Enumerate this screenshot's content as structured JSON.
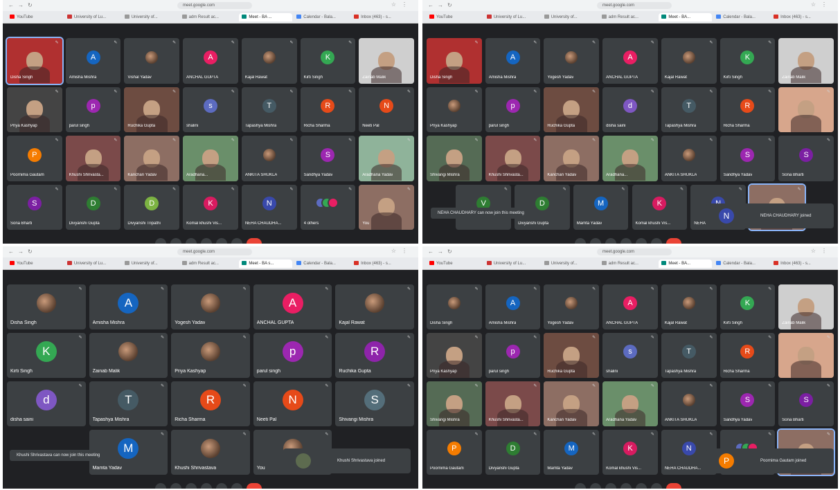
{
  "panels": [
    {
      "url": "meet.google.com",
      "big": false,
      "tabs": [
        {
          "label": "YouTube",
          "color": "#ff0000",
          "active": false
        },
        {
          "label": "University of Lu...",
          "color": "#cc3333",
          "active": false
        },
        {
          "label": "University of...",
          "color": "#999999",
          "active": false
        },
        {
          "label": "adm Result ac...",
          "color": "#999999",
          "active": false
        },
        {
          "label": "Meet - BA ...",
          "color": "#00897b",
          "active": true
        },
        {
          "label": "Calendar - Bala...",
          "color": "#4285f4",
          "active": false
        },
        {
          "label": "Inbox (463) - s...",
          "color": "#d93025",
          "active": false
        }
      ],
      "tiles": [
        {
          "name": "Disha Singh",
          "kind": "video",
          "color": "#b03030",
          "self": true
        },
        {
          "name": "Amisha Mishra",
          "kind": "avatar",
          "letter": "A",
          "color": "#1565c0"
        },
        {
          "name": "Vishal Yadav",
          "kind": "photo"
        },
        {
          "name": "ANCHAL GUPTA",
          "kind": "avatar",
          "letter": "A",
          "color": "#e91e63"
        },
        {
          "name": "Kajal Rawat",
          "kind": "photo"
        },
        {
          "name": "Kirti Singh",
          "kind": "avatar",
          "letter": "K",
          "color": "#34a853"
        },
        {
          "name": "Zainab Malik",
          "kind": "video",
          "color": "#cfcfcf"
        },
        {
          "name": "Priya Kashyap",
          "kind": "video",
          "color": "#444444"
        },
        {
          "name": "parul singh",
          "kind": "avatar",
          "letter": "p",
          "color": "#9c27b0"
        },
        {
          "name": "Ruchika Gupta",
          "kind": "video",
          "color": "#6d4c41"
        },
        {
          "name": "shalini",
          "kind": "avatar",
          "letter": "s",
          "color": "#5c6bc0"
        },
        {
          "name": "Tapashya Mishra",
          "kind": "avatar",
          "letter": "T",
          "color": "#455a64"
        },
        {
          "name": "Richa Sharma",
          "kind": "avatar",
          "letter": "R",
          "color": "#e64a19"
        },
        {
          "name": "Neeti Pal",
          "kind": "avatar",
          "letter": "N",
          "color": "#e64a19"
        },
        {
          "name": "Poornima Gautam",
          "kind": "avatar",
          "letter": "P",
          "color": "#f57c00"
        },
        {
          "name": "Khushi Shrivasta...",
          "kind": "video",
          "color": "#7b4a4a"
        },
        {
          "name": "Kanchan Yadav",
          "kind": "video",
          "color": "#8d6e63"
        },
        {
          "name": "Aradhana...",
          "kind": "video",
          "color": "#6a8f6a"
        },
        {
          "name": "ANKITA SHUKLA",
          "kind": "photo"
        },
        {
          "name": "Sandhya Yadav",
          "kind": "avatar",
          "letter": "S",
          "color": "#9c27b0"
        },
        {
          "name": "Aradhana Yadav",
          "kind": "video",
          "color": "#8fb39a"
        },
        {
          "name": "Sona Bharti",
          "kind": "avatar",
          "letter": "S",
          "color": "#7b1fa2"
        },
        {
          "name": "Divyanshi Gupta",
          "kind": "avatar",
          "letter": "D",
          "color": "#2e7d32"
        },
        {
          "name": "Divyanshi Tripathi",
          "kind": "avatar",
          "letter": "D",
          "color": "#7cb342"
        },
        {
          "name": "Komal khushi Vis...",
          "kind": "avatar",
          "letter": "K",
          "color": "#d81b60"
        },
        {
          "name": "NEHA CHAUDHA...",
          "kind": "avatar",
          "letter": "N",
          "color": "#3949ab"
        },
        {
          "name": "4 others",
          "kind": "others"
        },
        {
          "name": "You",
          "kind": "video",
          "color": "#8d6e63"
        }
      ]
    },
    {
      "url": "meet.google.com",
      "big": false,
      "tabs": [
        {
          "label": "YouTube",
          "color": "#ff0000",
          "active": false
        },
        {
          "label": "University of Lu...",
          "color": "#cc3333",
          "active": false
        },
        {
          "label": "University of...",
          "color": "#999999",
          "active": false
        },
        {
          "label": "adm Result ac...",
          "color": "#999999",
          "active": false
        },
        {
          "label": "Meet - BA...",
          "color": "#00897b",
          "active": true
        },
        {
          "label": "Calendar - Bala...",
          "color": "#4285f4",
          "active": false
        },
        {
          "label": "Inbox (463) - s...",
          "color": "#d93025",
          "active": false
        }
      ],
      "tiles": [
        {
          "name": "Disha Singh",
          "kind": "video",
          "color": "#b03030"
        },
        {
          "name": "Amisha Mishra",
          "kind": "avatar",
          "letter": "A",
          "color": "#1565c0"
        },
        {
          "name": "Yogesh Yadav",
          "kind": "photo"
        },
        {
          "name": "ANCHAL GUPTA",
          "kind": "avatar",
          "letter": "A",
          "color": "#e91e63"
        },
        {
          "name": "Kajal Rawat",
          "kind": "photo"
        },
        {
          "name": "Kirti Singh",
          "kind": "avatar",
          "letter": "K",
          "color": "#34a853"
        },
        {
          "name": "Zainab Malik",
          "kind": "video",
          "color": "#cfcfcf"
        },
        {
          "name": "Priya Kashyap",
          "kind": "photo"
        },
        {
          "name": "parul singh",
          "kind": "avatar",
          "letter": "p",
          "color": "#9c27b0"
        },
        {
          "name": "Ruchika Gupta",
          "kind": "video",
          "color": "#6d4c41"
        },
        {
          "name": "disha saini",
          "kind": "avatar",
          "letter": "d",
          "color": "#7e57c2"
        },
        {
          "name": "Tapashya Mishra",
          "kind": "avatar",
          "letter": "T",
          "color": "#455a64"
        },
        {
          "name": "Richa Sharma",
          "kind": "avatar",
          "letter": "R",
          "color": "#e64a19"
        },
        {
          "name": "",
          "kind": "video",
          "color": "#d7a68c"
        },
        {
          "name": "Shivangi Mishra",
          "kind": "video",
          "color": "#556b55"
        },
        {
          "name": "Khushi Shrivasta...",
          "kind": "video",
          "color": "#7b4a4a"
        },
        {
          "name": "Kanchan Yadav",
          "kind": "video",
          "color": "#8d6e63"
        },
        {
          "name": "Aradhana...",
          "kind": "video",
          "color": "#6a8f6a"
        },
        {
          "name": "ANKITA SHUKLA",
          "kind": "photo"
        },
        {
          "name": "Sandhya Yadav",
          "kind": "avatar",
          "letter": "S",
          "color": "#9c27b0"
        },
        {
          "name": "Sona Bharti",
          "kind": "avatar",
          "letter": "S",
          "color": "#7b1fa2"
        },
        {
          "name": "",
          "kind": "avatar",
          "letter": "V",
          "color": "#2e7d32"
        },
        {
          "name": "Divyanshi Gupta",
          "kind": "avatar",
          "letter": "D",
          "color": "#2e7d32"
        },
        {
          "name": "Mamta Yadav",
          "kind": "avatar",
          "letter": "M",
          "color": "#1565c0"
        },
        {
          "name": "Komal khushi Vis...",
          "kind": "avatar",
          "letter": "K",
          "color": "#d81b60"
        },
        {
          "name": "NEHA CHAUDHA...",
          "kind": "avatar",
          "letter": "N",
          "color": "#3949ab"
        },
        {
          "name": "",
          "kind": "video",
          "color": "#8d6e63",
          "self": true
        }
      ],
      "toast": "NEHA CHAUDHARY can now join this meeting",
      "joined": {
        "letter": "N",
        "color": "#3949ab",
        "text": "NEHA CHAUDHARY joined"
      }
    },
    {
      "url": "meet.google.com",
      "big": true,
      "tabs": [
        {
          "label": "YouTube",
          "color": "#ff0000",
          "active": false
        },
        {
          "label": "University of Lu...",
          "color": "#cc3333",
          "active": false
        },
        {
          "label": "University of...",
          "color": "#999999",
          "active": false
        },
        {
          "label": "adm Result ac...",
          "color": "#999999",
          "active": false
        },
        {
          "label": "Meet - BA s...",
          "color": "#00897b",
          "active": true
        },
        {
          "label": "Calendar - Bala...",
          "color": "#4285f4",
          "active": false
        },
        {
          "label": "Inbox (463) - s...",
          "color": "#d93025",
          "active": false
        }
      ],
      "tiles": [
        {
          "name": "Disha Singh",
          "kind": "photo"
        },
        {
          "name": "Amisha Mishra",
          "kind": "avatar",
          "letter": "A",
          "color": "#1565c0"
        },
        {
          "name": "Yogesh Yadav",
          "kind": "photo"
        },
        {
          "name": "ANCHAL GUPTA",
          "kind": "avatar",
          "letter": "A",
          "color": "#e91e63"
        },
        {
          "name": "Kajal Rawat",
          "kind": "photo"
        },
        {
          "name": "Kirti Singh",
          "kind": "avatar",
          "letter": "K",
          "color": "#34a853"
        },
        {
          "name": "Zainab Malik",
          "kind": "photo"
        },
        {
          "name": "Priya Kashyap",
          "kind": "photo"
        },
        {
          "name": "parul singh",
          "kind": "avatar",
          "letter": "p",
          "color": "#9c27b0"
        },
        {
          "name": "Ruchika Gupta",
          "kind": "avatar",
          "letter": "R",
          "color": "#8e24aa"
        },
        {
          "name": "disha saini",
          "kind": "avatar",
          "letter": "d",
          "color": "#7e57c2"
        },
        {
          "name": "Tapashya Mishra",
          "kind": "avatar",
          "letter": "T",
          "color": "#455a64"
        },
        {
          "name": "Richa Sharma",
          "kind": "avatar",
          "letter": "R",
          "color": "#e64a19"
        },
        {
          "name": "Neeti Pal",
          "kind": "avatar",
          "letter": "N",
          "color": "#e64a19"
        },
        {
          "name": "Shivangi Mishra",
          "kind": "avatar",
          "letter": "S",
          "color": "#546e7a"
        },
        {
          "name": "Mamta Yadav",
          "kind": "avatar",
          "letter": "M",
          "color": "#1565c0"
        },
        {
          "name": "Khushi Shrivastava",
          "kind": "photo"
        },
        {
          "name": "You",
          "kind": "photo"
        }
      ],
      "toast": "Khushi Shrivastava can now join this meeting",
      "joined": {
        "letter": "",
        "color": "#5d6b4f",
        "text": "Khushi Shrivastava joined"
      }
    },
    {
      "url": "meet.google.com",
      "big": false,
      "tabs": [
        {
          "label": "YouTube",
          "color": "#ff0000",
          "active": false
        },
        {
          "label": "University of Lu...",
          "color": "#cc3333",
          "active": false
        },
        {
          "label": "University of...",
          "color": "#999999",
          "active": false
        },
        {
          "label": "adm Result ac...",
          "color": "#999999",
          "active": false
        },
        {
          "label": "Meet - BA...",
          "color": "#00897b",
          "active": true
        },
        {
          "label": "Calendar - Bala...",
          "color": "#4285f4",
          "active": false
        },
        {
          "label": "Inbox (463) - s...",
          "color": "#d93025",
          "active": false
        }
      ],
      "tiles": [
        {
          "name": "Disha Singh",
          "kind": "photo"
        },
        {
          "name": "Amisha Mishra",
          "kind": "avatar",
          "letter": "A",
          "color": "#1565c0"
        },
        {
          "name": "Yogesh Yadav",
          "kind": "photo"
        },
        {
          "name": "ANCHAL GUPTA",
          "kind": "avatar",
          "letter": "A",
          "color": "#e91e63"
        },
        {
          "name": "Kajal Rawat",
          "kind": "photo"
        },
        {
          "name": "Kirti Singh",
          "kind": "avatar",
          "letter": "K",
          "color": "#34a853"
        },
        {
          "name": "Zainab Malik",
          "kind": "video",
          "color": "#cfcfcf"
        },
        {
          "name": "Priya Kashyap",
          "kind": "video",
          "color": "#444444"
        },
        {
          "name": "parul singh",
          "kind": "avatar",
          "letter": "p",
          "color": "#9c27b0"
        },
        {
          "name": "Ruchika Gupta",
          "kind": "video",
          "color": "#6d4c41"
        },
        {
          "name": "shalini",
          "kind": "avatar",
          "letter": "s",
          "color": "#5c6bc0"
        },
        {
          "name": "Tapashya Mishra",
          "kind": "avatar",
          "letter": "T",
          "color": "#455a64"
        },
        {
          "name": "Richa Sharma",
          "kind": "avatar",
          "letter": "R",
          "color": "#e64a19"
        },
        {
          "name": "",
          "kind": "video",
          "color": "#d7a68c"
        },
        {
          "name": "Shivangi Mishra",
          "kind": "video",
          "color": "#556b55"
        },
        {
          "name": "Khushi Shrivasta...",
          "kind": "video",
          "color": "#7b4a4a"
        },
        {
          "name": "Kanchan Yadav",
          "kind": "video",
          "color": "#8d6e63"
        },
        {
          "name": "Aradhana Yadav",
          "kind": "video",
          "color": "#6a8f6a"
        },
        {
          "name": "ANKITA SHUKLA",
          "kind": "photo"
        },
        {
          "name": "Sandhya Yadav",
          "kind": "avatar",
          "letter": "S",
          "color": "#9c27b0"
        },
        {
          "name": "Sona Bharti",
          "kind": "avatar",
          "letter": "S",
          "color": "#7b1fa2"
        },
        {
          "name": "Poornima Gautam",
          "kind": "avatar",
          "letter": "P",
          "color": "#f57c00"
        },
        {
          "name": "Divyanshi Gupta",
          "kind": "avatar",
          "letter": "D",
          "color": "#2e7d32"
        },
        {
          "name": "Mamta Yadav",
          "kind": "avatar",
          "letter": "M",
          "color": "#1565c0"
        },
        {
          "name": "Komal khushi Vis...",
          "kind": "avatar",
          "letter": "K",
          "color": "#d81b60"
        },
        {
          "name": "NEHA CHAUDHA...",
          "kind": "avatar",
          "letter": "N",
          "color": "#3949ab"
        },
        {
          "name": "2 others",
          "kind": "others"
        },
        {
          "name": "",
          "kind": "video",
          "color": "#8d6e63",
          "self": true
        }
      ],
      "joined": {
        "letter": "P",
        "color": "#f57c00",
        "text": "Poornima Gautam joined"
      }
    }
  ]
}
